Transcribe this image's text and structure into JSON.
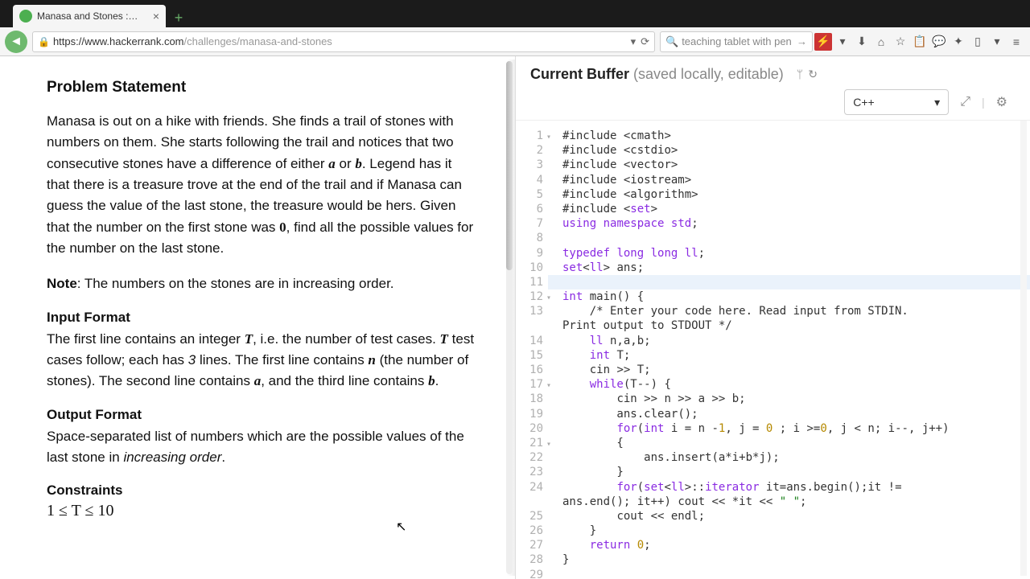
{
  "browser": {
    "tab_title": "Manasa and Stones :…",
    "url_domain": "https://www.hackerrank.com",
    "url_path": "/challenges/manasa-and-stones",
    "search_text": "teaching tablet with pen"
  },
  "problem": {
    "heading": "Problem Statement",
    "para1_a": "Manasa is out on a hike with friends. She finds a trail of stones with numbers on them. She starts following the trail and notices that two consecutive stones have a difference of either ",
    "a": "a",
    "para1_b": " or ",
    "b": "b",
    "para1_c": ". Legend has it that there is a treasure trove at the end of the trail and if Manasa can guess the value of the last stone, the treasure would be hers. Given that the number on the first stone was ",
    "zero": "0",
    "para1_d": ", find all the possible values for the number on the last stone.",
    "note_label": "Note",
    "note_text": ": The numbers on the stones are in increasing order.",
    "input_heading": "Input Format",
    "input_a": "The first line contains an integer ",
    "T": "T",
    "input_b": ", i.e. the number of test cases. ",
    "input_c": " test cases follow; each has ",
    "three": "3",
    "input_d": " lines. The first line contains ",
    "n": "n",
    "input_e": " (the number of stones). The second line contains ",
    "input_f": ", and the third line contains ",
    "input_g": ".",
    "output_heading": "Output Format",
    "output_a": "Space-separated list of numbers which are the possible values of the last stone in ",
    "output_i": "increasing order",
    "output_b": ".",
    "constraints_heading": "Constraints",
    "constraint1": "1 ≤ T ≤ 10"
  },
  "buffer": {
    "title_strong": "Current Buffer",
    "title_sub": "(saved locally, editable)",
    "language": "C++"
  },
  "code": [
    "#include <cmath>",
    "#include <cstdio>",
    "#include <vector>",
    "#include <iostream>",
    "#include <algorithm>",
    "#include <set>",
    "using namespace std;",
    "",
    "typedef long long ll;",
    "set<ll> ans;",
    "",
    "int main() {",
    "    /* Enter your code here. Read input from STDIN. Print output to STDOUT */",
    "    ll n,a,b;",
    "    int T;",
    "    cin >> T;",
    "    while(T--) {",
    "        cin >> n >> a >> b;",
    "        ans.clear();",
    "        for(int i = n -1, j = 0 ; i >=0, j < n; i--, j++)",
    "        {",
    "            ans.insert(a*i+b*j);",
    "        }",
    "        for(set<ll>::iterator it=ans.begin();it != ans.end(); it++) cout << *it << \" \";",
    "        cout << endl;",
    "    }",
    "    return 0;",
    "}",
    ""
  ],
  "fold_lines": [
    1,
    12,
    17,
    21
  ]
}
